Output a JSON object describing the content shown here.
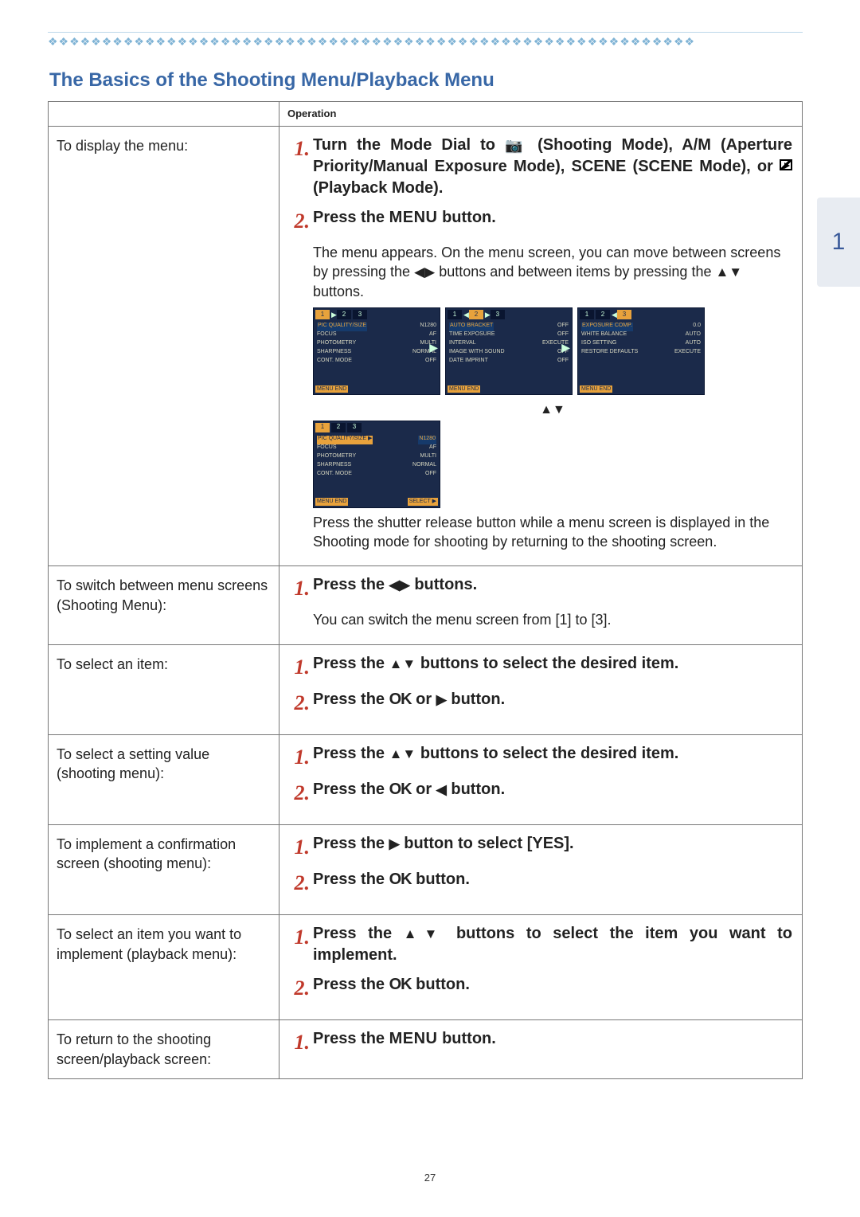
{
  "page_number": "27",
  "tab_number": "1",
  "diamonds": "❖❖❖❖❖❖❖❖❖❖❖❖❖❖❖❖❖❖❖❖❖❖❖❖❖❖❖❖❖❖❖❖❖❖❖❖❖❖❖❖❖❖❖❖❖❖❖❖❖❖❖❖❖❖❖❖❖❖❖❖",
  "section_title": "The Basics of the Shooting Menu/Playback Menu",
  "header_operation": "Operation",
  "rows": {
    "r1": {
      "label": "To display the menu:",
      "step1_a": "Turn the Mode Dial to ",
      "step1_b": " (Shooting Mode), A/M (Aperture Priority/Manual Exposure Mode), SCENE (SCENE Mode), or ",
      "step1_c": " (Playback Mode).",
      "step2": "Press the ",
      "step2_menu": "MENU",
      "step2_b": " button.",
      "para1_a": "The menu appears. On the menu screen, you can move between screens by pressing the ",
      "para1_b": " buttons and between items by pressing the ",
      "para1_c": " buttons.",
      "screens": {
        "s1": {
          "tabs": [
            "1",
            "2",
            "3"
          ],
          "active": 0,
          "rows": [
            [
              "PIC QUALITY/SIZE",
              "N1280"
            ],
            [
              "FOCUS",
              "AF"
            ],
            [
              "PHOTOMETRY",
              "MULTI"
            ],
            [
              "SHARPNESS",
              "NORMAL"
            ],
            [
              "CONT. MODE",
              "OFF"
            ]
          ],
          "footer_left": "MENU END"
        },
        "s2": {
          "tabs": [
            "1",
            "2",
            "3"
          ],
          "active": 1,
          "rows": [
            [
              "AUTO BRACKET",
              "OFF"
            ],
            [
              "TIME EXPOSURE",
              "OFF"
            ],
            [
              "INTERVAL",
              "EXECUTE"
            ],
            [
              "IMAGE WITH SOUND",
              "OFF"
            ],
            [
              "DATE IMPRINT",
              "OFF"
            ]
          ],
          "footer_left": "MENU END"
        },
        "s3": {
          "tabs": [
            "1",
            "2",
            "3"
          ],
          "active": 2,
          "rows": [
            [
              "EXPOSURE COMP.",
              "0.0"
            ],
            [
              "WHITE BALANCE",
              "AUTO"
            ],
            [
              "ISO SETTING",
              "AUTO"
            ],
            [
              "RESTORE DEFAULTS",
              "EXECUTE"
            ]
          ],
          "footer_left": "MENU END"
        },
        "s4": {
          "tabs": [
            "1",
            "2",
            "3"
          ],
          "active": 0,
          "rows_hl": [
            [
              "PIC QUALITY/SIZE ▶",
              "N1280"
            ],
            [
              "FOCUS",
              "AF"
            ],
            [
              "PHOTOMETRY",
              "MULTI"
            ],
            [
              "SHARPNESS",
              "NORMAL"
            ],
            [
              "CONT. MODE",
              "OFF"
            ]
          ],
          "footer_left": "MENU END",
          "footer_right": "SELECT ▶"
        }
      },
      "updown_glyph": "▲▼",
      "para2": "Press the shutter release button while a menu screen is displayed in the Shooting mode for shooting by returning to the shooting screen."
    },
    "r2": {
      "label": "To switch between menu screens (Shooting Menu):",
      "step1_a": "Press the ",
      "step1_b": " buttons.",
      "para": "You can switch the menu screen from [1] to [3]."
    },
    "r3": {
      "label": "To select an item:",
      "step1_a": "Press the ",
      "step1_b": " buttons to select the desired item.",
      "step2_a": "Press the ",
      "step2_ok": "OK",
      "step2_b": " or ",
      "step2_c": " button."
    },
    "r4": {
      "label": "To select a setting value (shooting menu):",
      "step1_a": "Press the ",
      "step1_b": " buttons to select the desired item.",
      "step2_a": "Press the ",
      "step2_ok": "OK",
      "step2_b": " or ",
      "step2_c": " button."
    },
    "r5": {
      "label": "To implement a confirmation screen (shooting menu):",
      "step1_a": "Press the ",
      "step1_b": " button to select [YES].",
      "step2_a": "Press the ",
      "step2_ok": "OK",
      "step2_b": " button."
    },
    "r6": {
      "label": "To select an item you want to implement (playback menu):",
      "step1_a": "Press the ",
      "step1_b": " buttons to select the item you want to implement.",
      "step2_a": "Press the ",
      "step2_ok": "OK",
      "step2_b": " button."
    },
    "r7": {
      "label": "To return to the shooting screen/playback screen:",
      "step1_a": "Press the ",
      "step1_menu": "MENU",
      "step1_b": " button."
    }
  },
  "glyphs": {
    "lr": "◀▶",
    "ud": "▲▼",
    "right": "▶",
    "left": "◀",
    "camera": "📷"
  }
}
